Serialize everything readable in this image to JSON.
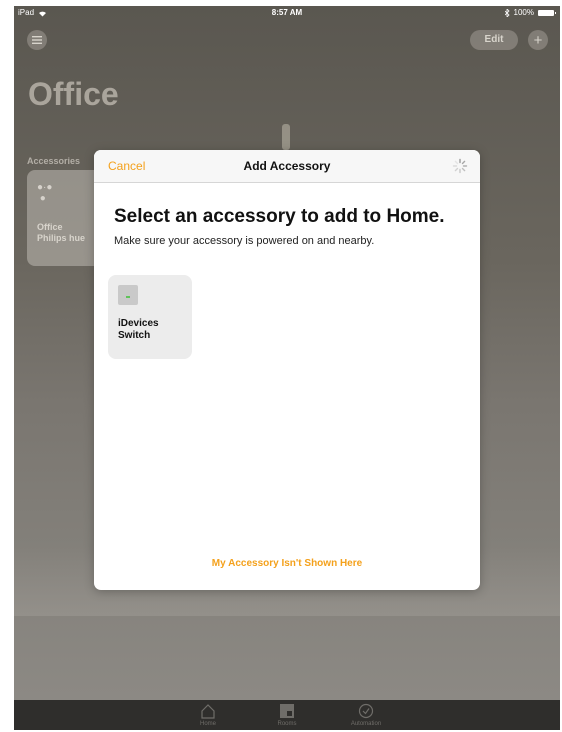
{
  "status_bar": {
    "device": "iPad",
    "time": "8:57 AM",
    "battery": "100%"
  },
  "background": {
    "edit_label": "Edit",
    "page_title": "Office",
    "section_label": "Accessories",
    "tile": {
      "name_line1": "Office",
      "name_line2": "Philips hue"
    }
  },
  "modal": {
    "cancel_label": "Cancel",
    "title": "Add Accessory",
    "heading": "Select an accessory to add to Home.",
    "subheading": "Make sure your accessory is powered on and nearby.",
    "accessories": [
      {
        "name_line1": "iDevices",
        "name_line2": "Switch",
        "icon": "switch-icon"
      }
    ],
    "not_shown_label": "My Accessory Isn't Shown Here"
  },
  "tab_bar": {
    "tabs": [
      {
        "label": "Home",
        "icon": "home-icon"
      },
      {
        "label": "Rooms",
        "icon": "rooms-icon"
      },
      {
        "label": "Automation",
        "icon": "automation-icon"
      }
    ]
  },
  "colors": {
    "accent": "#f4a11c",
    "modal_background": "#ffffff",
    "tile_background": "#ececec"
  }
}
